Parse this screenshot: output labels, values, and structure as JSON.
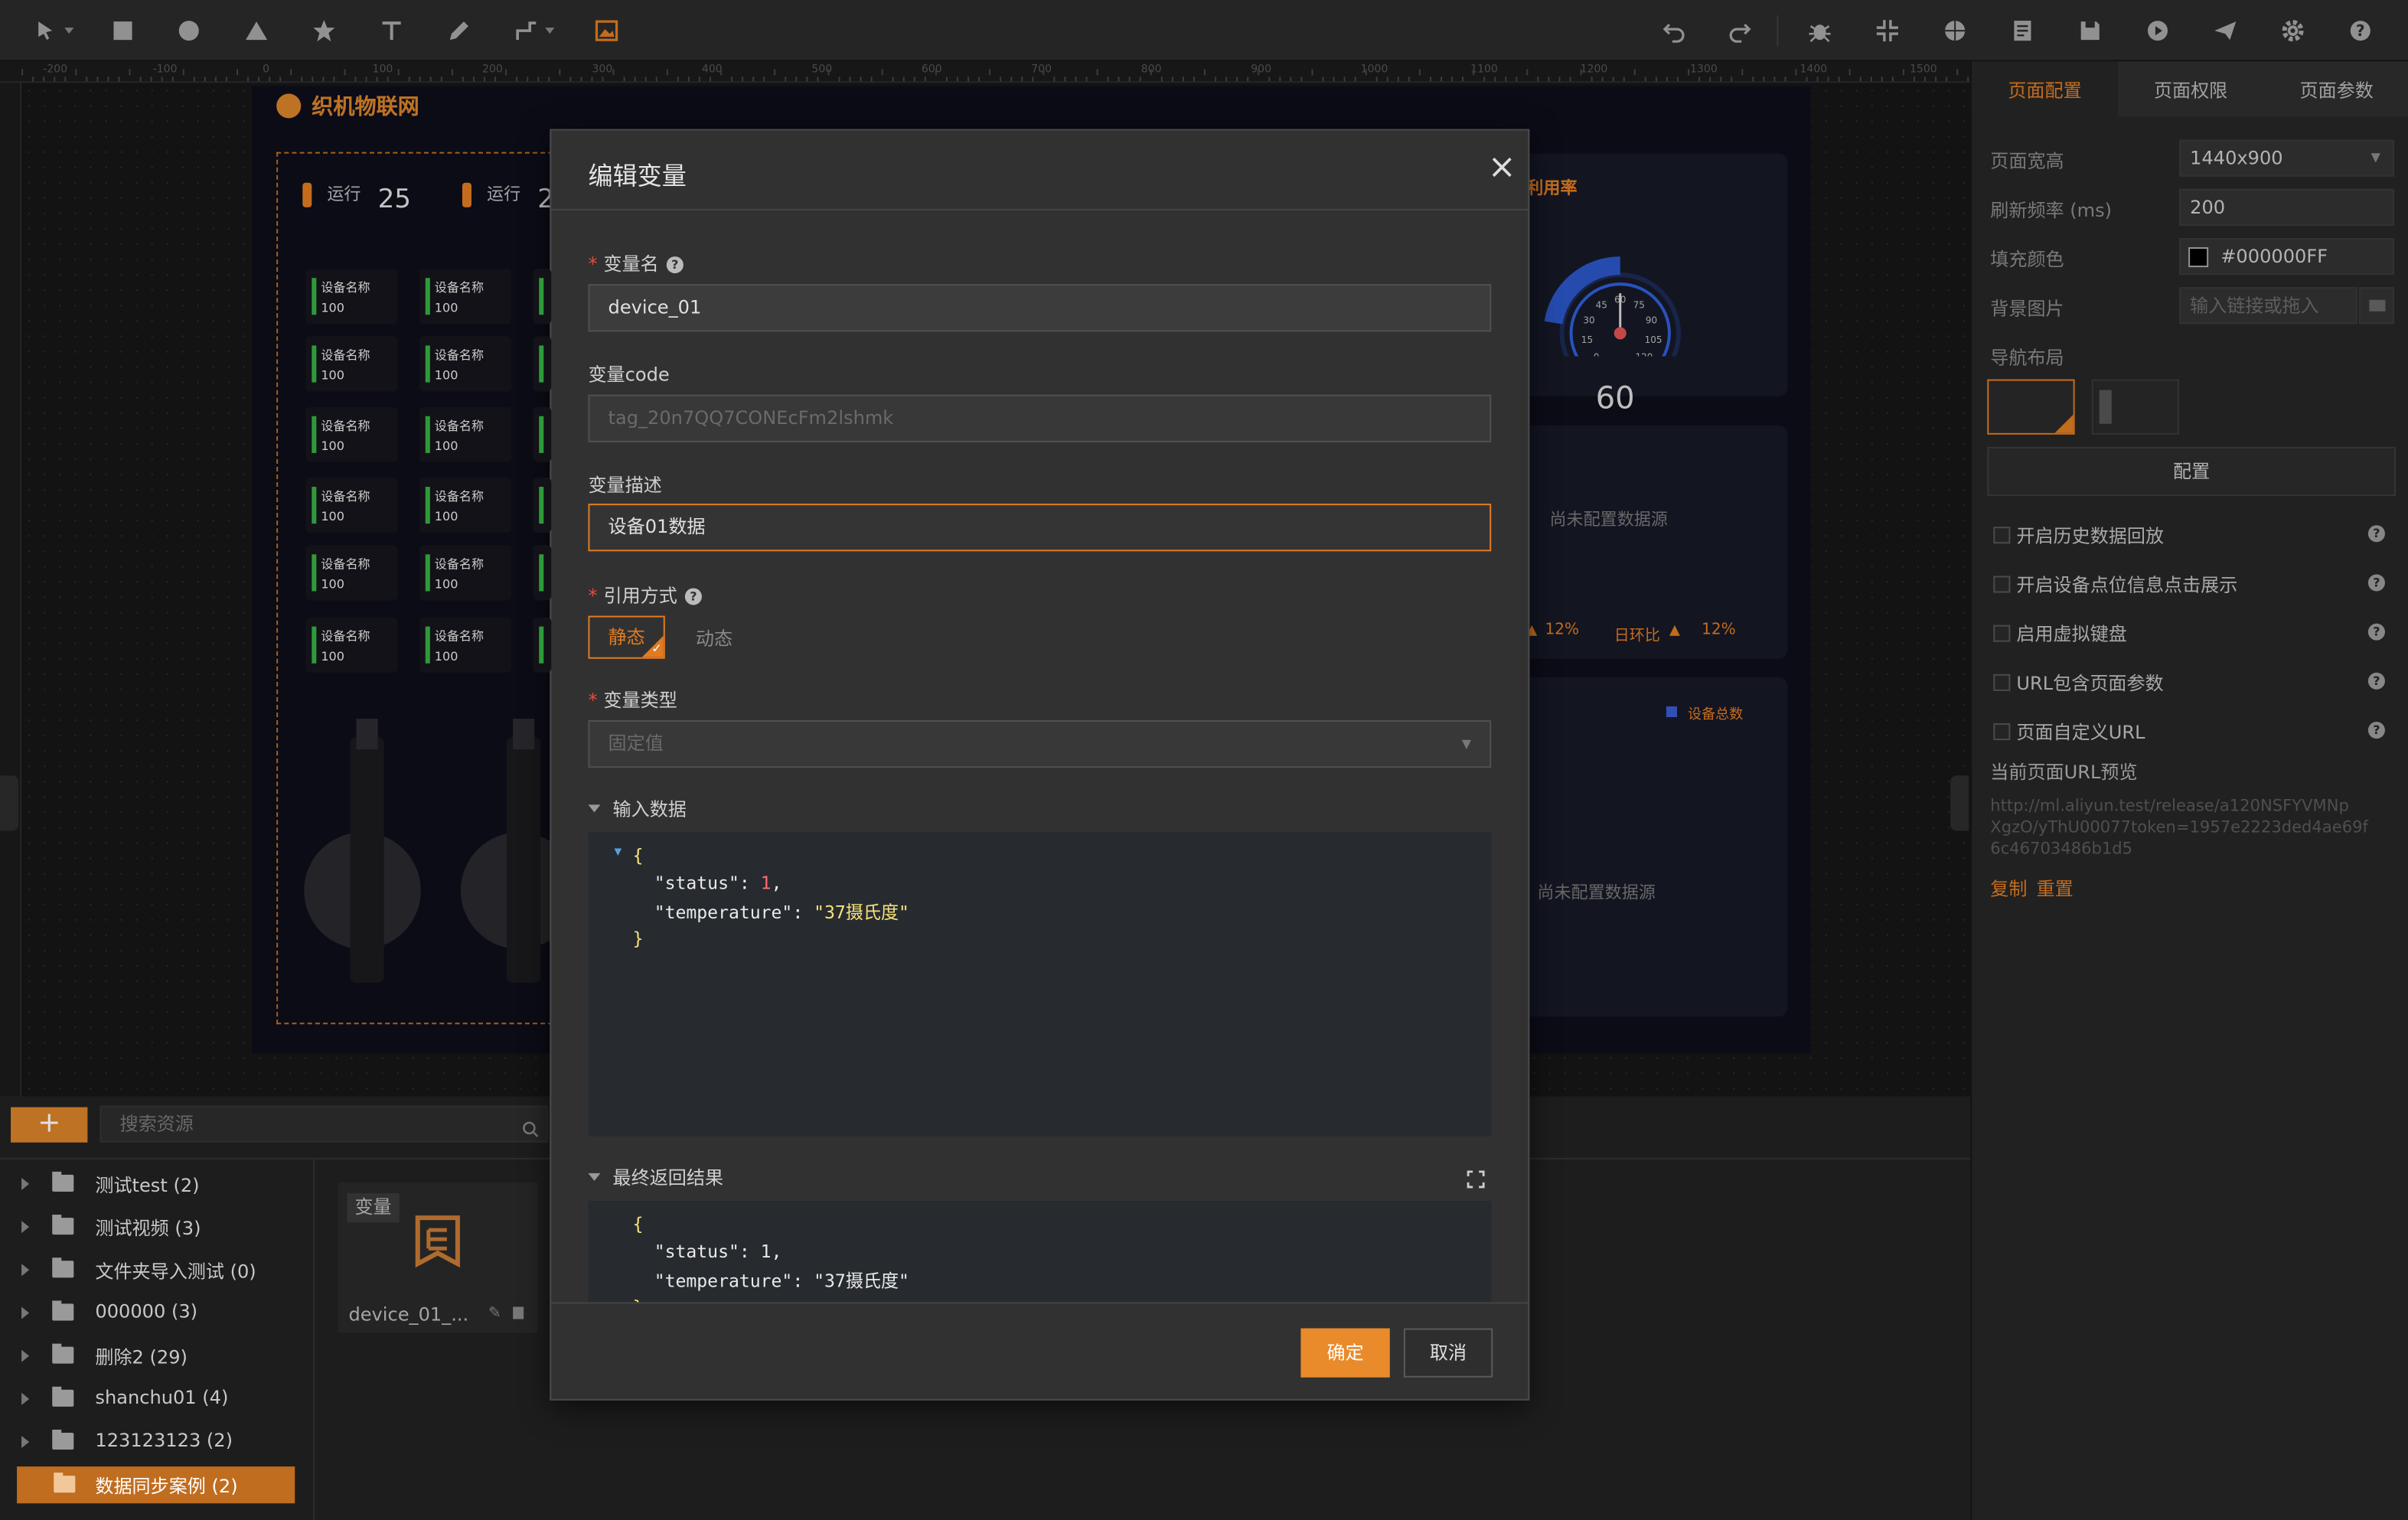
{
  "header": {
    "toolbar_left": [
      "select-tool",
      "rectangle-tool",
      "circle-tool",
      "triangle-tool",
      "star-tool",
      "text-tool",
      "pen-tool",
      "connector-tool",
      "image-tool"
    ],
    "toolbar_right": [
      "undo",
      "redo",
      "debug",
      "collapse",
      "globe",
      "document",
      "save",
      "preview",
      "publish",
      "settings",
      "help"
    ]
  },
  "canvas": {
    "ruler_labels": [
      "-200",
      "-100",
      "0",
      "100",
      "200",
      "300",
      "400",
      "500",
      "600",
      "700",
      "800",
      "900",
      "1000",
      "1100",
      "1200",
      "1300",
      "1400",
      "1500"
    ],
    "app_logo": "织机物联网",
    "stats": [
      {
        "label": "运行",
        "value": "25"
      },
      {
        "label": "运行",
        "value": "2"
      }
    ],
    "device_name": "设备名称",
    "device_value": "100",
    "gauge_title": "利用率",
    "gauge_ticks": [
      "0",
      "15",
      "30",
      "45",
      "60",
      "75",
      "90",
      "105",
      "120"
    ],
    "gauge_value": "60",
    "no_data_1": "尚未配置数据源",
    "no_data_2": "尚未配置数据源",
    "pct_left": "12%",
    "daily_ratio_label": "日环比",
    "pct_right": "12%",
    "legend_label": "设备总数"
  },
  "right_panel": {
    "tabs": [
      "页面配置",
      "页面权限",
      "页面参数"
    ],
    "page_size_label": "页面宽高",
    "page_size_value": "1440x900",
    "refresh_label": "刷新频率 (ms)",
    "refresh_value": "200",
    "fill_label": "填充颜色",
    "fill_value": "#000000FF",
    "bg_label": "背景图片",
    "bg_placeholder": "输入链接或拖入",
    "nav_label": "导航布局",
    "config_button": "配置",
    "options": [
      "开启历史数据回放",
      "开启设备点位信息点击展示",
      "启用虚拟键盘",
      "URL包含页面参数",
      "页面自定义URL"
    ],
    "url_preview_label": "当前页面URL预览",
    "url_preview_lines": [
      "http://ml.aliyun.test/release/a120NSFYVMNp",
      "XgzO/yThU00077token=1957e2223ded4ae69f",
      "6c46703486b1d5"
    ],
    "copy": "复制",
    "reset": "重置",
    "accent": "#e07b22"
  },
  "bottom_panel": {
    "add_label": "+",
    "search_placeholder": "搜索资源",
    "tree": [
      "测试test (2)",
      "测试视频 (3)",
      "文件夹导入测试 (0)",
      "000000 (3)",
      "删除2 (29)",
      "shanchu01 (4)",
      "123123123 (2)",
      "数据同步案例 (2)"
    ],
    "asset_badge": "变量",
    "asset_name": "device_01_..."
  },
  "modal": {
    "title": "编辑变量",
    "close": "×",
    "name_label": "变量名",
    "name_value": "device_01",
    "code_label": "变量code",
    "code_value": "tag_20n7QQ7CONEcFm2lshmk",
    "desc_label": "变量描述",
    "desc_value": "设备01数据",
    "ref_label": "引用方式",
    "ref_static": "静态",
    "ref_dynamic": "动态",
    "type_label": "变量类型",
    "type_value": "固定值",
    "input_section": "输入数据",
    "result_section": "最终返回结果",
    "json_open": "{",
    "json_close": "}",
    "json_status_key": "\"status\"",
    "json_status_val": "1",
    "json_temp_key": "\"temperature\"",
    "json_temp_val": "\"37摄氏度\"",
    "ok": "确定",
    "cancel": "取消"
  }
}
